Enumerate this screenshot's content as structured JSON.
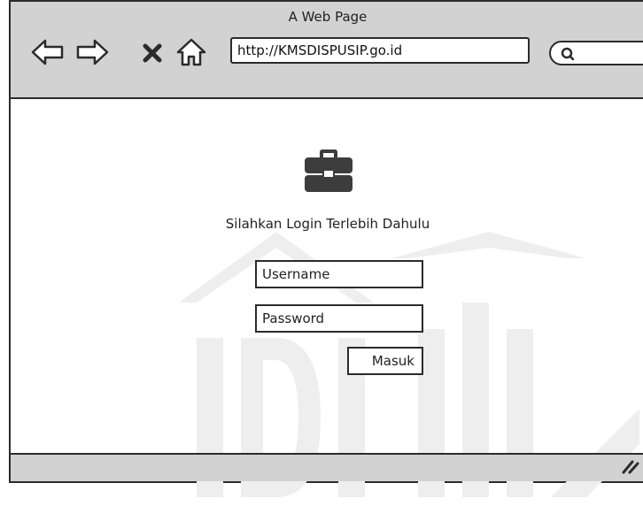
{
  "browser": {
    "page_title": "A Web Page",
    "address": "http://KMSDISPUSIP.go.id",
    "icons": [
      "back-arrow-icon",
      "forward-arrow-icon",
      "close-icon",
      "home-icon",
      "search-icon",
      "resize-grip-icon"
    ]
  },
  "login": {
    "icon": "briefcase-icon",
    "prompt": "Silahkan Login Terlebih Dahulu",
    "username_placeholder": "Username",
    "password_placeholder": "Password",
    "submit_label": "Masuk"
  },
  "colors": {
    "chrome": "#d2d2d2",
    "ink": "#2b2b2b",
    "icon": "#3d3d3d",
    "watermark": "#eeeeee"
  }
}
